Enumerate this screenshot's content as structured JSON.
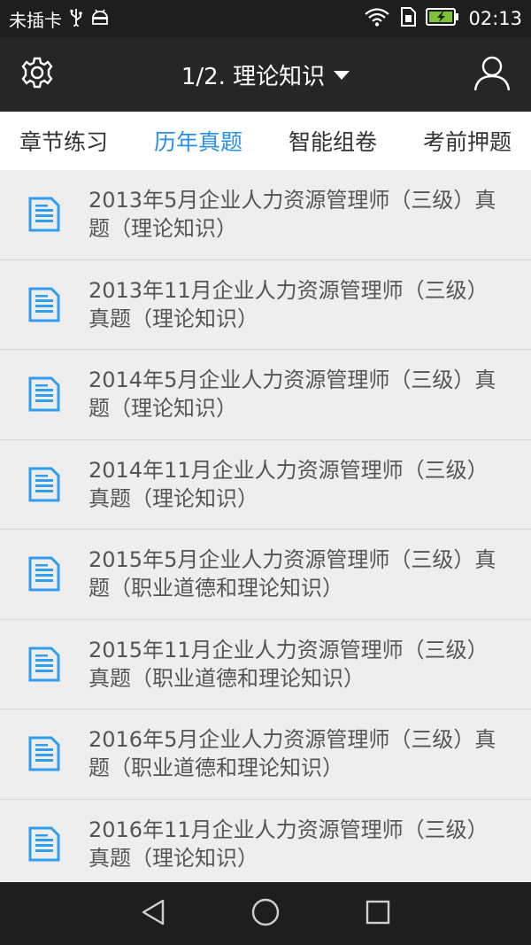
{
  "status_bar": {
    "carrier": "未插卡",
    "usb_icon": "usb-icon",
    "android_icon": "android-debug-icon",
    "wifi_icon": "wifi-icon",
    "sim_icon": "sim-icon",
    "battery_icon": "battery-charging-icon",
    "time": "02:13"
  },
  "app_bar": {
    "settings_icon": "gear-icon",
    "title": "1/2. 理论知识",
    "account_icon": "user-icon"
  },
  "tabs": [
    {
      "label": "章节练习",
      "active": false
    },
    {
      "label": "历年真题",
      "active": true
    },
    {
      "label": "智能组卷",
      "active": false
    },
    {
      "label": "考前押题",
      "active": false
    }
  ],
  "items": [
    {
      "title": "2013年5月企业人力资源管理师（三级）真题（理论知识）"
    },
    {
      "title": "2013年11月企业人力资源管理师（三级）真题（理论知识）"
    },
    {
      "title": "2014年5月企业人力资源管理师（三级）真题（理论知识）"
    },
    {
      "title": "2014年11月企业人力资源管理师（三级）真题（理论知识）"
    },
    {
      "title": "2015年5月企业人力资源管理师（三级）真题（职业道德和理论知识）"
    },
    {
      "title": "2015年11月企业人力资源管理师（三级）真题（职业道德和理论知识）"
    },
    {
      "title": "2016年5月企业人力资源管理师（三级）真题（职业道德和理论知识）"
    },
    {
      "title": "2016年11月企业人力资源管理师（三级）真题（理论知识）"
    }
  ],
  "colors": {
    "accent": "#2a8fe6",
    "icon_blue": "#2f9df0"
  },
  "nav_bar": {
    "back_icon": "back-triangle-icon",
    "home_icon": "home-circle-icon",
    "recents_icon": "recents-square-icon"
  }
}
